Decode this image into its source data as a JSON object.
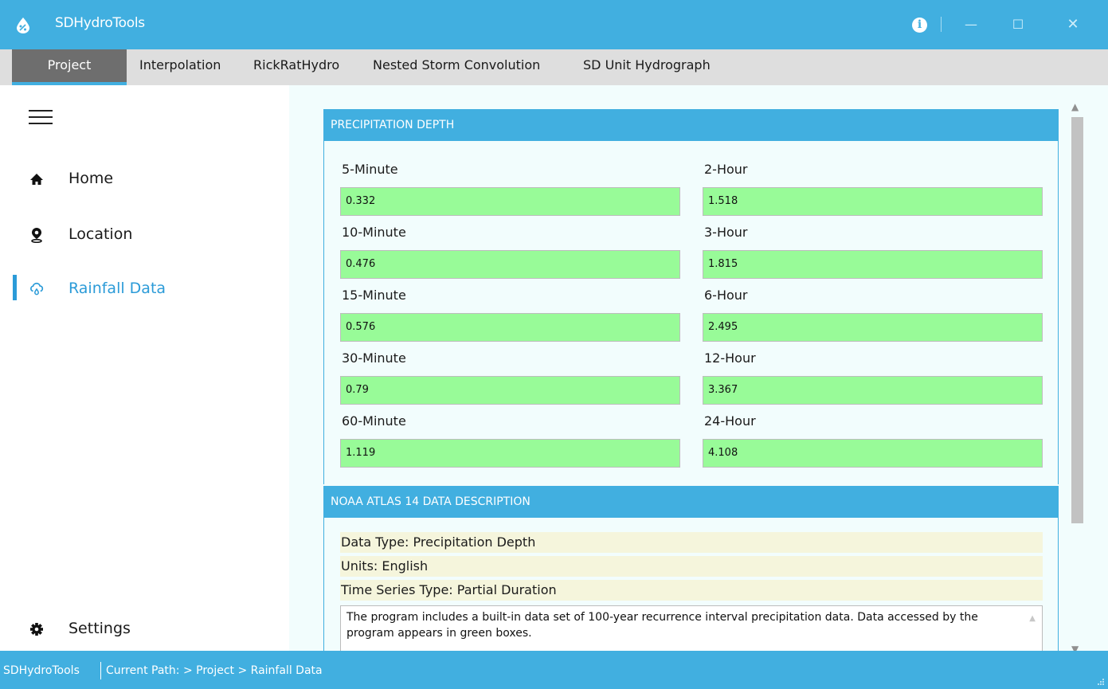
{
  "window": {
    "title": "SDHydroTools",
    "info_icon": "i",
    "minimize_icon": "—",
    "maximize_icon": "☐",
    "close_icon": "✕"
  },
  "menu": {
    "items": [
      {
        "label": "Project",
        "active": true
      },
      {
        "label": "Interpolation"
      },
      {
        "label": "RickRatHydro"
      },
      {
        "label": "Nested Storm Convolution"
      },
      {
        "label": "SD Unit Hydrograph"
      }
    ]
  },
  "sidebar": {
    "items": [
      {
        "label": "Home",
        "icon": "home-icon"
      },
      {
        "label": "Location",
        "icon": "location-pin-icon"
      },
      {
        "label": "Rainfall Data",
        "icon": "cloud-rain-icon",
        "active": true
      }
    ],
    "settings": {
      "label": "Settings",
      "icon": "gear-icon"
    }
  },
  "precipitation": {
    "header": "PRECIPITATION DEPTH",
    "left": [
      {
        "label": "5-Minute",
        "value": "0.332"
      },
      {
        "label": "10-Minute",
        "value": "0.476"
      },
      {
        "label": "15-Minute",
        "value": "0.576"
      },
      {
        "label": "30-Minute",
        "value": "0.79"
      },
      {
        "label": "60-Minute",
        "value": "1.119"
      }
    ],
    "right": [
      {
        "label": "2-Hour",
        "value": "1.518"
      },
      {
        "label": "3-Hour",
        "value": "1.815"
      },
      {
        "label": "6-Hour",
        "value": "2.495"
      },
      {
        "label": "12-Hour",
        "value": "3.367"
      },
      {
        "label": "24-Hour",
        "value": "4.108"
      }
    ]
  },
  "description": {
    "header": "NOAA ATLAS 14 DATA DESCRIPTION",
    "data_type": "Data Type: Precipitation Depth",
    "units": "Units: English",
    "series_type": "Time Series Type: Partial Duration",
    "text": "The program includes a built-in data set of 100-year recurrence interval precipitation data. Data accessed by the program appears in green boxes."
  },
  "status": {
    "app": "SDHydroTools",
    "path": "Current Path:  > Project > Rainfall Data"
  },
  "colors": {
    "accent": "#41afe0",
    "active_nav": "#2b9bd8",
    "green_box": "#98fb98",
    "content_bg": "#f2fdfd",
    "desc_bg": "#f5f5dc"
  }
}
